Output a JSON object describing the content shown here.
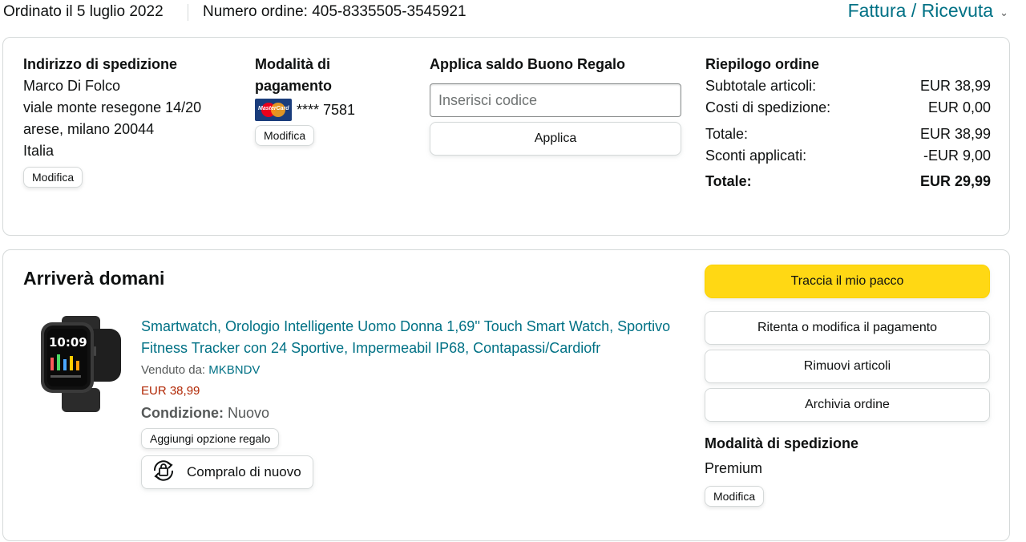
{
  "header": {
    "order_date": "Ordinato il 5 luglio 2022",
    "order_number": "Numero ordine: 405-8335505-3545921",
    "invoice_link": "Fattura / Ricevuta"
  },
  "shipping_address": {
    "heading": "Indirizzo di spedizione",
    "lines": [
      "Marco Di Folco",
      "viale monte resegone 14/20",
      "arese, milano 20044",
      "Italia"
    ],
    "edit_label": "Modifica"
  },
  "payment": {
    "heading": "Modalità di pagamento",
    "card_masked": "**** 7581",
    "card_brand_logo_text": "MasterCard",
    "edit_label": "Modifica"
  },
  "gift_card": {
    "heading": "Applica saldo Buono Regalo",
    "input_placeholder": "Inserisci codice",
    "apply_label": "Applica"
  },
  "summary": {
    "heading": "Riepilogo ordine",
    "rows": [
      {
        "label": "Subtotale articoli:",
        "value": "EUR 38,99"
      },
      {
        "label": "Costi di spedizione:",
        "value": "EUR 0,00"
      },
      {
        "label": "Totale:",
        "value": "EUR 38,99"
      },
      {
        "label": "Sconti applicati:",
        "value": "-EUR 9,00"
      }
    ],
    "grand_total_label": "Totale:",
    "grand_total_value": "EUR 29,99"
  },
  "shipment": {
    "status": "Arriverà domani",
    "item": {
      "title": "Smartwatch, Orologio Intelligente Uomo Donna 1,69'' Touch Smart Watch, Sportivo Fitness Tracker con 24 Sportive, Impermeabil IP68, Contapassi/Cardiofr",
      "seller_prefix": "Venduto da:",
      "seller_name": "MKBNDV",
      "price": "EUR 38,99",
      "condition_label": "Condizione:",
      "condition_value": "Nuovo",
      "gift_option_label": "Aggiungi opzione regalo",
      "buy_again_label": "Compralo di nuovo",
      "watch_time": "10:09"
    },
    "actions": {
      "track": "Traccia il mio pacco",
      "retry_payment": "Ritenta o modifica il pagamento",
      "remove_items": "Rimuovi articoli",
      "archive": "Archivia ordine"
    },
    "shipping_method": {
      "heading": "Modalità di spedizione",
      "value": "Premium",
      "edit_label": "Modifica"
    }
  },
  "colors": {
    "link": "#007185",
    "price": "#B12704",
    "primary_button": "#FFD814",
    "border": "#D5D9D9"
  }
}
